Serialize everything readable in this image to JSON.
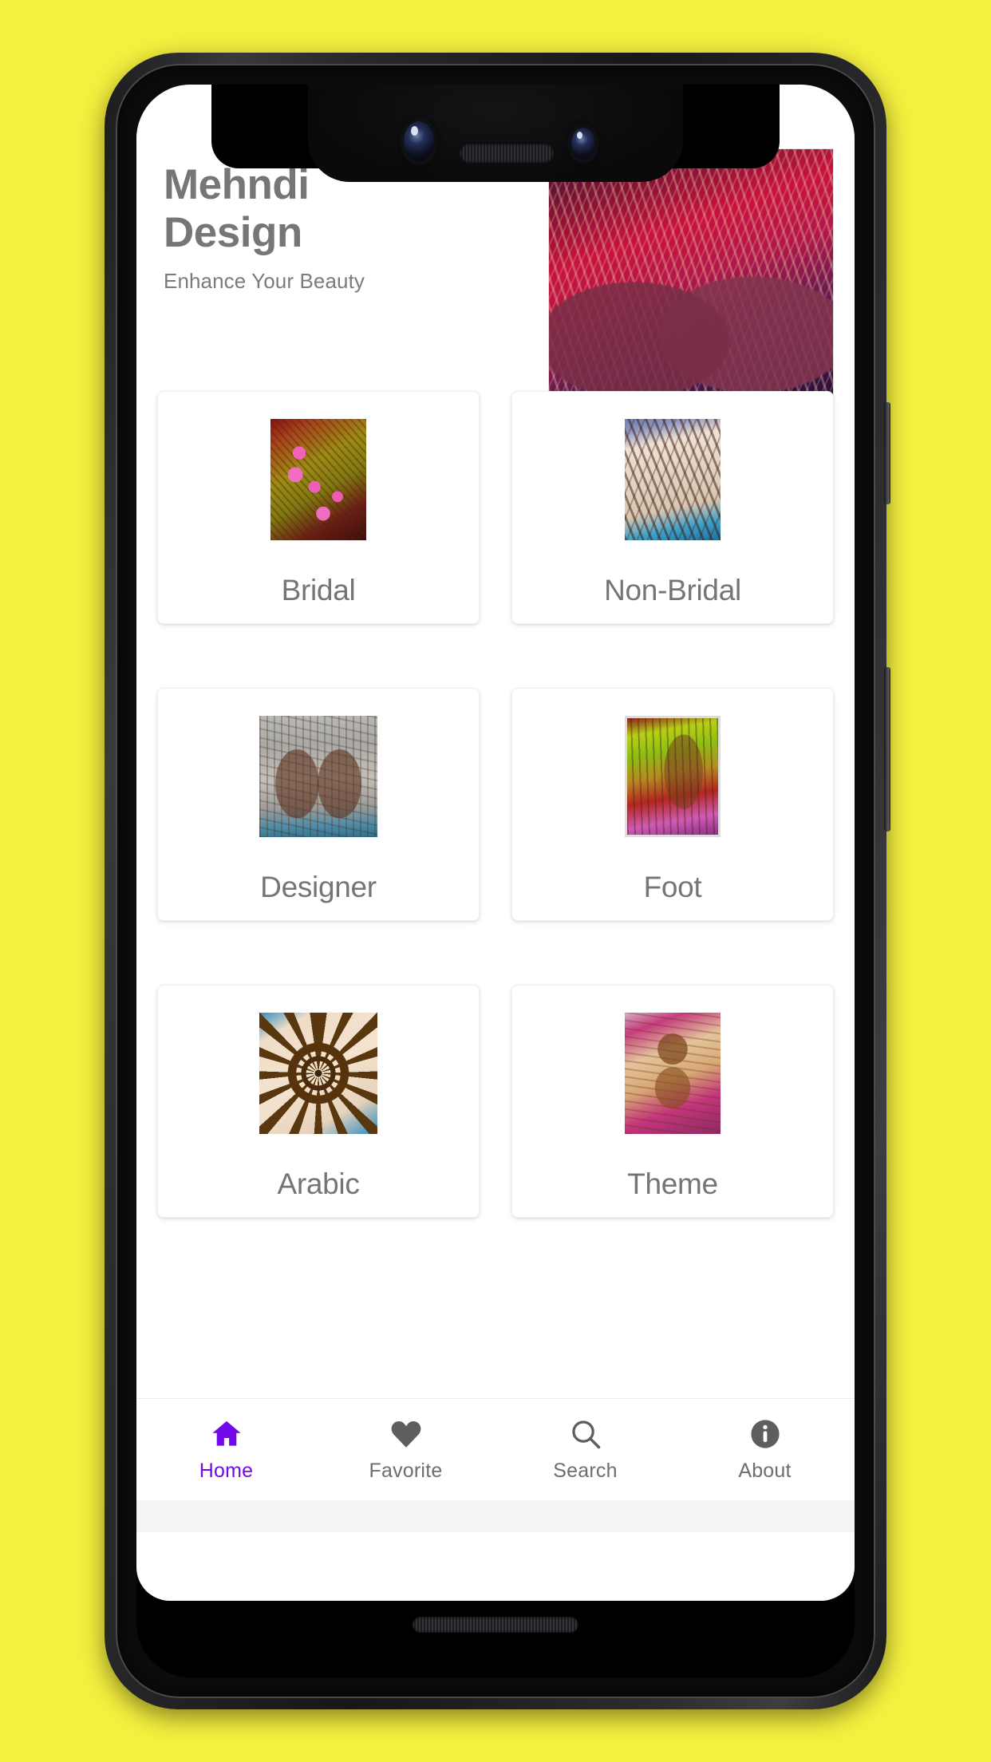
{
  "background": {
    "color": "#F4F03F"
  },
  "app": {
    "title": "Mehndi Design",
    "subtitle": "Enhance Your Beauty",
    "hero_image_alt": "bridal-mehndi-hands-hero",
    "accent_color": "#7209E8",
    "text_color": "#757575"
  },
  "categories": [
    {
      "label": "Bridal",
      "thumb": "bridal-mehndi-thumb"
    },
    {
      "label": "Non-Bridal",
      "thumb": "non-bridal-mehndi-thumb"
    },
    {
      "label": "Designer",
      "thumb": "designer-mehndi-thumb"
    },
    {
      "label": "Foot",
      "thumb": "foot-mehndi-thumb"
    },
    {
      "label": "Arabic",
      "thumb": "arabic-mehndi-thumb"
    },
    {
      "label": "Theme",
      "thumb": "theme-mehndi-thumb"
    }
  ],
  "bottom_nav": {
    "active_index": 0,
    "items": [
      {
        "label": "Home",
        "icon": "home-icon",
        "active": true
      },
      {
        "label": "Favorite",
        "icon": "heart-icon",
        "active": false
      },
      {
        "label": "Search",
        "icon": "search-icon",
        "active": false
      },
      {
        "label": "About",
        "icon": "info-icon",
        "active": false
      }
    ]
  },
  "device": {
    "notch": "front-camera-notch",
    "cameras": [
      "front-camera-primary",
      "front-camera-secondary"
    ],
    "earpiece": "earpiece-speaker",
    "bottom_speaker": "bottom-speaker-grille",
    "side_buttons": [
      "volume-button",
      "power-button"
    ]
  }
}
